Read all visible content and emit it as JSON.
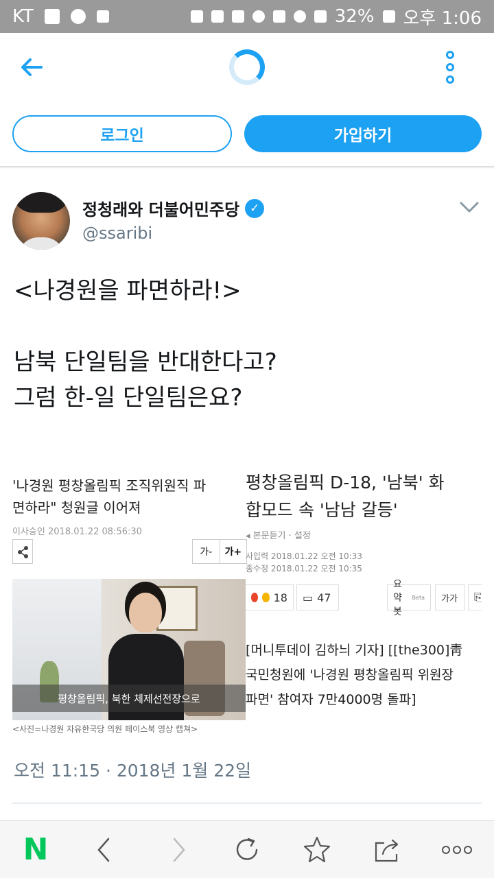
{
  "status_bar": {
    "carrier": "KT",
    "battery": "32%",
    "time": "오후 1:06",
    "icons": [
      "image-icon",
      "notification-icon",
      "usb-icon",
      "battery-saver-icon",
      "bluetooth-icon",
      "mute-icon",
      "alarm-icon",
      "hd-icon",
      "wifi-icon",
      "signal-icon",
      "battery-icon"
    ]
  },
  "header": {
    "back_icon": "arrow-left-icon",
    "loading_icon": "loading-spinner-icon",
    "more_icon": "vertical-dots-icon",
    "login_label": "로그인",
    "signup_label": "가입하기",
    "accent_color": "#1da1f2"
  },
  "tweet": {
    "author_name": "정청래와 더불어민주당",
    "verified_icon": "verified-badge-icon",
    "handle": "@ssaribi",
    "text_lines": [
      "<나경원을 파면하라!>",
      "",
      "남북 단일팀을 반대한다고?",
      "그럼 한-일 단일팀은요?"
    ],
    "timestamp": "오전 11:15 · 2018년 1월 22일"
  },
  "media": {
    "left_article": {
      "title_line1": "'나경원 평창올림픽 조직위원직 파",
      "title_line2": "면하라\" 청원글 이어져",
      "meta": "이사승인 2018.01.22  08:56:30",
      "share_icon": "share-icon",
      "font_small": "가-",
      "font_large": "가+",
      "photo_caption": "평창올림픽, 북한 체제선전장으로",
      "photo_credit": "<사진=나경원 자유한국당 의원 페이스북 영상 캡쳐>"
    },
    "right_article": {
      "title_line1": "평창올림픽 D-18, '남북' 화",
      "title_line2": "합모드 속 '남남 갈등'",
      "meta_listen": "본문듣기 · 설정",
      "meta_input": "사입력  2018.01.22 오전 10:33",
      "meta_modified": "종수정  2018.01.22 오전 10:35",
      "reaction_count": "18",
      "comment_count": "47",
      "summary_label": "요약봇",
      "summary_badge": "Beta",
      "font_label": "가가",
      "body_line1": "[머니투데이 김하늬 기자] [[the300]靑",
      "body_line2": "국민청원에 '나경원 평창올림픽 위원장",
      "body_line3": "파면' 참여자 7만4000명 돌파]"
    }
  },
  "bottom_bar": {
    "home_label": "N",
    "home_color": "#03c75a",
    "icons": [
      "browser-back-icon",
      "browser-forward-icon",
      "refresh-icon",
      "bookmark-star-icon",
      "share-icon",
      "more-horizontal-icon"
    ]
  }
}
